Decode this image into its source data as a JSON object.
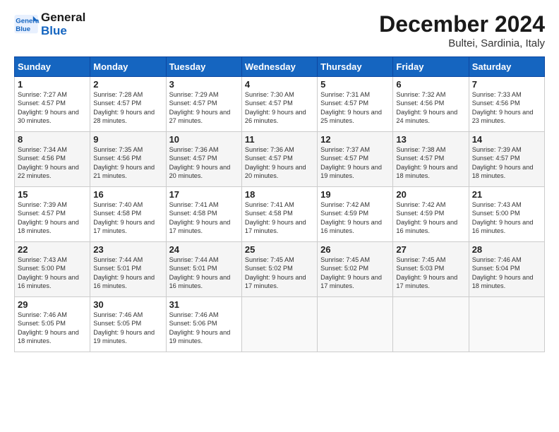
{
  "logo": {
    "line1": "General",
    "line2": "Blue"
  },
  "title": "December 2024",
  "location": "Bultei, Sardinia, Italy",
  "days_of_week": [
    "Sunday",
    "Monday",
    "Tuesday",
    "Wednesday",
    "Thursday",
    "Friday",
    "Saturday"
  ],
  "weeks": [
    [
      {
        "day": "1",
        "sunrise": "Sunrise: 7:27 AM",
        "sunset": "Sunset: 4:57 PM",
        "daylight": "Daylight: 9 hours and 30 minutes."
      },
      {
        "day": "2",
        "sunrise": "Sunrise: 7:28 AM",
        "sunset": "Sunset: 4:57 PM",
        "daylight": "Daylight: 9 hours and 28 minutes."
      },
      {
        "day": "3",
        "sunrise": "Sunrise: 7:29 AM",
        "sunset": "Sunset: 4:57 PM",
        "daylight": "Daylight: 9 hours and 27 minutes."
      },
      {
        "day": "4",
        "sunrise": "Sunrise: 7:30 AM",
        "sunset": "Sunset: 4:57 PM",
        "daylight": "Daylight: 9 hours and 26 minutes."
      },
      {
        "day": "5",
        "sunrise": "Sunrise: 7:31 AM",
        "sunset": "Sunset: 4:57 PM",
        "daylight": "Daylight: 9 hours and 25 minutes."
      },
      {
        "day": "6",
        "sunrise": "Sunrise: 7:32 AM",
        "sunset": "Sunset: 4:56 PM",
        "daylight": "Daylight: 9 hours and 24 minutes."
      },
      {
        "day": "7",
        "sunrise": "Sunrise: 7:33 AM",
        "sunset": "Sunset: 4:56 PM",
        "daylight": "Daylight: 9 hours and 23 minutes."
      }
    ],
    [
      {
        "day": "8",
        "sunrise": "Sunrise: 7:34 AM",
        "sunset": "Sunset: 4:56 PM",
        "daylight": "Daylight: 9 hours and 22 minutes."
      },
      {
        "day": "9",
        "sunrise": "Sunrise: 7:35 AM",
        "sunset": "Sunset: 4:56 PM",
        "daylight": "Daylight: 9 hours and 21 minutes."
      },
      {
        "day": "10",
        "sunrise": "Sunrise: 7:36 AM",
        "sunset": "Sunset: 4:57 PM",
        "daylight": "Daylight: 9 hours and 20 minutes."
      },
      {
        "day": "11",
        "sunrise": "Sunrise: 7:36 AM",
        "sunset": "Sunset: 4:57 PM",
        "daylight": "Daylight: 9 hours and 20 minutes."
      },
      {
        "day": "12",
        "sunrise": "Sunrise: 7:37 AM",
        "sunset": "Sunset: 4:57 PM",
        "daylight": "Daylight: 9 hours and 19 minutes."
      },
      {
        "day": "13",
        "sunrise": "Sunrise: 7:38 AM",
        "sunset": "Sunset: 4:57 PM",
        "daylight": "Daylight: 9 hours and 18 minutes."
      },
      {
        "day": "14",
        "sunrise": "Sunrise: 7:39 AM",
        "sunset": "Sunset: 4:57 PM",
        "daylight": "Daylight: 9 hours and 18 minutes."
      }
    ],
    [
      {
        "day": "15",
        "sunrise": "Sunrise: 7:39 AM",
        "sunset": "Sunset: 4:57 PM",
        "daylight": "Daylight: 9 hours and 18 minutes."
      },
      {
        "day": "16",
        "sunrise": "Sunrise: 7:40 AM",
        "sunset": "Sunset: 4:58 PM",
        "daylight": "Daylight: 9 hours and 17 minutes."
      },
      {
        "day": "17",
        "sunrise": "Sunrise: 7:41 AM",
        "sunset": "Sunset: 4:58 PM",
        "daylight": "Daylight: 9 hours and 17 minutes."
      },
      {
        "day": "18",
        "sunrise": "Sunrise: 7:41 AM",
        "sunset": "Sunset: 4:58 PM",
        "daylight": "Daylight: 9 hours and 17 minutes."
      },
      {
        "day": "19",
        "sunrise": "Sunrise: 7:42 AM",
        "sunset": "Sunset: 4:59 PM",
        "daylight": "Daylight: 9 hours and 16 minutes."
      },
      {
        "day": "20",
        "sunrise": "Sunrise: 7:42 AM",
        "sunset": "Sunset: 4:59 PM",
        "daylight": "Daylight: 9 hours and 16 minutes."
      },
      {
        "day": "21",
        "sunrise": "Sunrise: 7:43 AM",
        "sunset": "Sunset: 5:00 PM",
        "daylight": "Daylight: 9 hours and 16 minutes."
      }
    ],
    [
      {
        "day": "22",
        "sunrise": "Sunrise: 7:43 AM",
        "sunset": "Sunset: 5:00 PM",
        "daylight": "Daylight: 9 hours and 16 minutes."
      },
      {
        "day": "23",
        "sunrise": "Sunrise: 7:44 AM",
        "sunset": "Sunset: 5:01 PM",
        "daylight": "Daylight: 9 hours and 16 minutes."
      },
      {
        "day": "24",
        "sunrise": "Sunrise: 7:44 AM",
        "sunset": "Sunset: 5:01 PM",
        "daylight": "Daylight: 9 hours and 16 minutes."
      },
      {
        "day": "25",
        "sunrise": "Sunrise: 7:45 AM",
        "sunset": "Sunset: 5:02 PM",
        "daylight": "Daylight: 9 hours and 17 minutes."
      },
      {
        "day": "26",
        "sunrise": "Sunrise: 7:45 AM",
        "sunset": "Sunset: 5:02 PM",
        "daylight": "Daylight: 9 hours and 17 minutes."
      },
      {
        "day": "27",
        "sunrise": "Sunrise: 7:45 AM",
        "sunset": "Sunset: 5:03 PM",
        "daylight": "Daylight: 9 hours and 17 minutes."
      },
      {
        "day": "28",
        "sunrise": "Sunrise: 7:46 AM",
        "sunset": "Sunset: 5:04 PM",
        "daylight": "Daylight: 9 hours and 18 minutes."
      }
    ],
    [
      {
        "day": "29",
        "sunrise": "Sunrise: 7:46 AM",
        "sunset": "Sunset: 5:05 PM",
        "daylight": "Daylight: 9 hours and 18 minutes."
      },
      {
        "day": "30",
        "sunrise": "Sunrise: 7:46 AM",
        "sunset": "Sunset: 5:05 PM",
        "daylight": "Daylight: 9 hours and 19 minutes."
      },
      {
        "day": "31",
        "sunrise": "Sunrise: 7:46 AM",
        "sunset": "Sunset: 5:06 PM",
        "daylight": "Daylight: 9 hours and 19 minutes."
      },
      null,
      null,
      null,
      null
    ]
  ]
}
